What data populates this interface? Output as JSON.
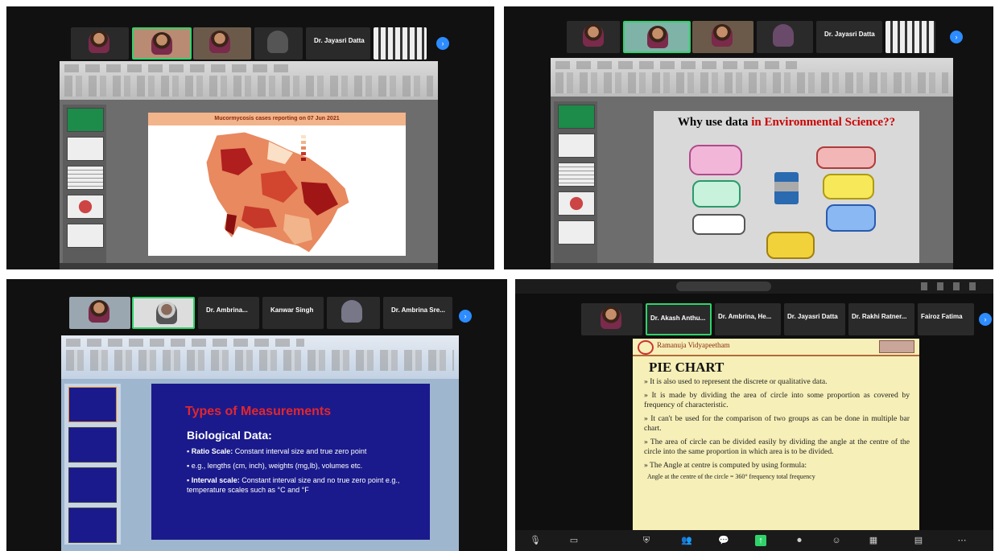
{
  "q1": {
    "participants": [
      {
        "name": "Dr. Jayasri Datta"
      }
    ],
    "slide": {
      "title_banner": "Mucormycosis cases reporting on 07 Jun 2021"
    }
  },
  "q2": {
    "participants": [
      {
        "name": "Dr. Jayasri Datta"
      }
    ],
    "slide": {
      "title_part1": "Why use data ",
      "title_part2": "in Environmental Science??"
    }
  },
  "q3": {
    "participants": [
      {
        "name": "Dr. Ambrina..."
      },
      {
        "name": "Kanwar Singh"
      },
      {
        "name": "Dr. Ambrina Sre..."
      }
    ],
    "slide": {
      "title": "Types of Measurements",
      "subtitle": "Biological Data:",
      "bullets": [
        {
          "label": "Ratio Scale:",
          "text": " Constant interval size and true zero point"
        },
        {
          "label": "",
          "text": "e.g., lengths (cm, inch), weights (mg,lb), volumes etc."
        },
        {
          "label": "Interval scale:",
          "text": " Constant interval size and no true zero point e.g., temperature scales such as °C and °F"
        }
      ]
    }
  },
  "q4": {
    "participants": [
      {
        "name": "Dr. Akash Anthu..."
      },
      {
        "name": "Dr. Ambrina, He..."
      },
      {
        "name": "Dr. Jayasri Datta"
      },
      {
        "name": "Dr. Rakhi Ratner..."
      },
      {
        "name": "Fairoz Fatima"
      }
    ],
    "slide": {
      "header": "Ramanuja Vidyapeetham",
      "title": "PIE CHART",
      "bullets": [
        "It is also used to represent the discrete or qualitative data.",
        "It is made by dividing the area of circle into some proportion as covered by frequency of characteristic.",
        "It can't be used for the comparison of two groups as can be done in multiple bar chart.",
        "The area of circle can be divided easily by dividing the angle at the centre of the circle into the same proportion in which area is to be divided.",
        "The Angle at centre is computed by using formula:",
        "Angle at the centre of the circle = 360° frequency total frequency"
      ]
    }
  },
  "colors": {
    "zoom_blue": "#2d8cff",
    "speaker_green": "#2fd36a",
    "map_dark": "#a01616",
    "slide_blue": "#1a1a8c",
    "slide_red": "#e3262b",
    "pie_bg": "#f6efb7"
  }
}
